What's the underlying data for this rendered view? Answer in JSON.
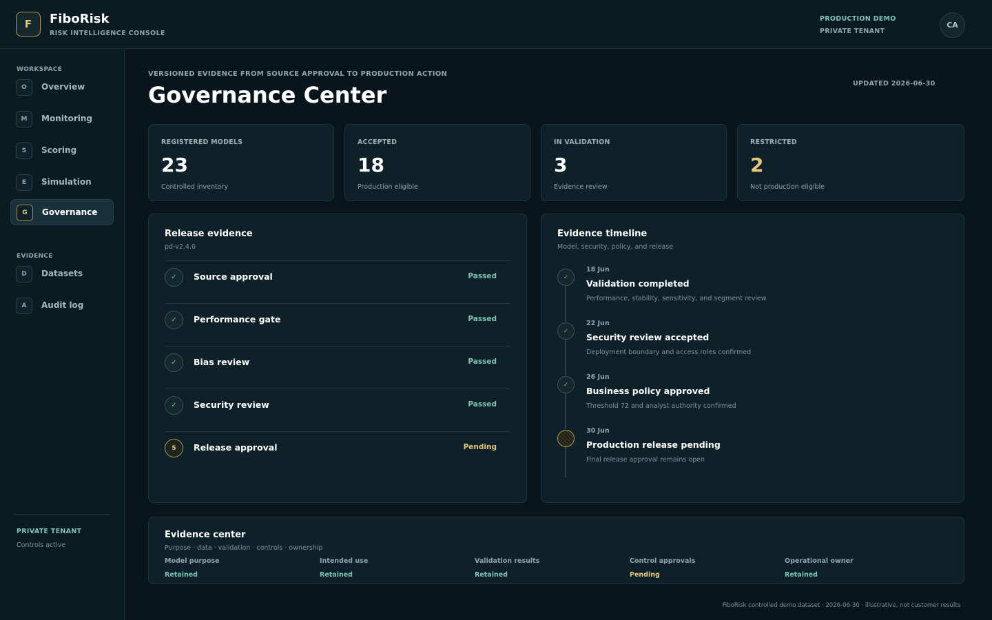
{
  "header": {
    "logo_letter": "F",
    "brand_name": "FiboRisk",
    "brand_subtitle": "RISK INTELLIGENCE CONSOLE",
    "environment": "PRODUCTION DEMO",
    "tenant": "PRIVATE TENANT",
    "avatar_initials": "CA"
  },
  "sidebar": {
    "sections": [
      {
        "title": "WORKSPACE"
      },
      {
        "title": "EVIDENCE"
      }
    ],
    "items": [
      {
        "badge": "O",
        "label": "Overview",
        "active": false
      },
      {
        "badge": "M",
        "label": "Monitoring",
        "active": false
      },
      {
        "badge": "S",
        "label": "Scoring",
        "active": false
      },
      {
        "badge": "E",
        "label": "Simulation",
        "active": false
      },
      {
        "badge": "G",
        "label": "Governance",
        "active": true
      },
      {
        "badge": "D",
        "label": "Datasets",
        "active": false
      },
      {
        "badge": "A",
        "label": "Audit log",
        "active": false
      }
    ],
    "footer_title": "PRIVATE TENANT",
    "footer_subtitle": "Controls active"
  },
  "page": {
    "eyebrow": "VERSIONED EVIDENCE FROM SOURCE APPROVAL TO PRODUCTION ACTION",
    "title": "Governance Center",
    "updated": "UPDATED 2026-06-30"
  },
  "stats": [
    {
      "label": "REGISTERED MODELS",
      "value": "23",
      "note": "Controlled inventory"
    },
    {
      "label": "ACCEPTED",
      "value": "18",
      "note": "Production eligible"
    },
    {
      "label": "IN VALIDATION",
      "value": "3",
      "note": "Evidence review"
    },
    {
      "label": "RESTRICTED",
      "value": "2",
      "note": "Not production eligible"
    }
  ],
  "release": {
    "title": "Release evidence",
    "version": "pd-v2.4.0",
    "rows": [
      {
        "icon": "check-icon",
        "mark": "✓",
        "label": "Source approval",
        "status": "Passed"
      },
      {
        "icon": "check-icon",
        "mark": "✓",
        "label": "Performance gate",
        "status": "Passed"
      },
      {
        "icon": "check-icon",
        "mark": "✓",
        "label": "Bias review",
        "status": "Passed"
      },
      {
        "icon": "check-icon",
        "mark": "✓",
        "label": "Security review",
        "status": "Passed"
      },
      {
        "icon": "step-5-icon",
        "mark": "5",
        "label": "Release approval",
        "status": "Pending"
      }
    ]
  },
  "timeline": {
    "title": "Evidence timeline",
    "subtitle": "Model, security, policy, and release",
    "events": [
      {
        "mark": "✓",
        "date": "18 Jun",
        "title": "Validation completed",
        "desc": "Performance, stability, sensitivity, and segment review"
      },
      {
        "mark": "✓",
        "date": "22 Jun",
        "title": "Security review accepted",
        "desc": "Deployment boundary and access roles confirmed"
      },
      {
        "mark": "✓",
        "date": "26 Jun",
        "title": "Business policy approved",
        "desc": "Threshold 72 and analyst authority confirmed"
      },
      {
        "mark": "",
        "date": "30 Jun",
        "title": "Production release pending",
        "desc": "Final release approval remains open"
      }
    ]
  },
  "evidence_center": {
    "title": "Evidence center",
    "subtitle": "Purpose · data · validation · controls · ownership",
    "columns": [
      {
        "label": "Model purpose",
        "value": "Retained"
      },
      {
        "label": "Intended use",
        "value": "Retained"
      },
      {
        "label": "Validation results",
        "value": "Retained"
      },
      {
        "label": "Control approvals",
        "value": "Pending"
      },
      {
        "label": "Operational owner",
        "value": "Retained"
      }
    ]
  },
  "footnote": "FiboRisk controlled demo dataset · 2026-06-30 · illustrative, not customer results",
  "colors": {
    "background": "#08151c",
    "accent_teal": "#7fc4b4",
    "accent_gold": "#e7c77a"
  }
}
